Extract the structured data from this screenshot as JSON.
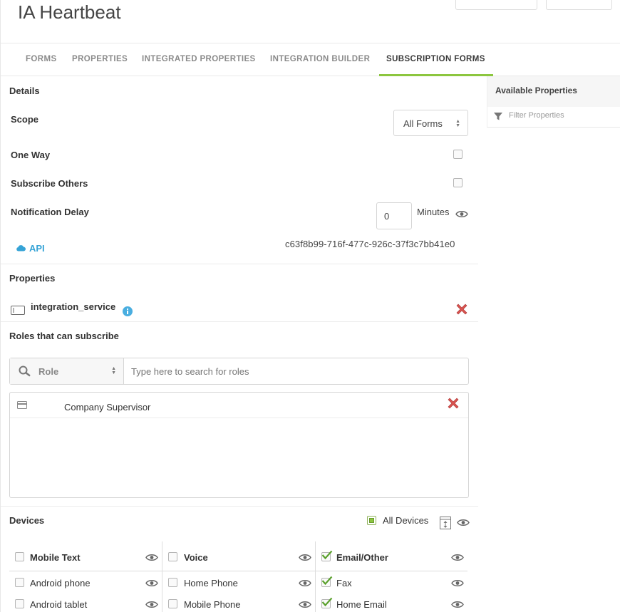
{
  "header": {
    "title": "IA Heartbeat"
  },
  "tabs": [
    {
      "label": "FORMS"
    },
    {
      "label": "PROPERTIES"
    },
    {
      "label": "INTEGRATED PROPERTIES"
    },
    {
      "label": "INTEGRATION BUILDER"
    },
    {
      "label": "SUBSCRIPTION FORMS"
    }
  ],
  "active_tab": "SUBSCRIPTION FORMS",
  "sidepanel": {
    "title": "Available Properties",
    "filter_placeholder": "Filter Properties"
  },
  "details": {
    "title": "Details",
    "scope_label": "Scope",
    "scope_value": "All Forms",
    "one_way_label": "One Way",
    "one_way_checked": false,
    "subscribe_others_label": "Subscribe Others",
    "subscribe_others_checked": false,
    "notification_delay_label": "Notification Delay",
    "notification_delay_value": "0",
    "minutes_label": "Minutes",
    "api_label": "API",
    "api_id": "c63f8b99-716f-477c-926c-37f3c7bb41e0"
  },
  "properties": {
    "title": "Properties",
    "items": [
      {
        "name": "integration_service"
      }
    ]
  },
  "roles": {
    "title": "Roles that can subscribe",
    "filter_label": "Role",
    "search_placeholder": "Type here to search for roles",
    "items": [
      {
        "name": "Company Supervisor"
      }
    ]
  },
  "devices": {
    "title": "Devices",
    "all_devices_label": "All Devices",
    "columns": [
      {
        "label": "Mobile Text",
        "checked": false,
        "items": [
          {
            "label": "Android phone",
            "checked": false
          },
          {
            "label": "Android tablet",
            "checked": false
          }
        ]
      },
      {
        "label": "Voice",
        "checked": false,
        "items": [
          {
            "label": "Home Phone",
            "checked": false
          },
          {
            "label": "Mobile Phone",
            "checked": false
          }
        ]
      },
      {
        "label": "Email/Other",
        "checked": true,
        "items": [
          {
            "label": "Fax",
            "checked": true
          },
          {
            "label": "Home Email",
            "checked": true
          }
        ]
      }
    ]
  },
  "colors": {
    "accent_green": "#8cc63f",
    "link_blue": "#35a3d6",
    "delete_red": "#d9534f"
  }
}
